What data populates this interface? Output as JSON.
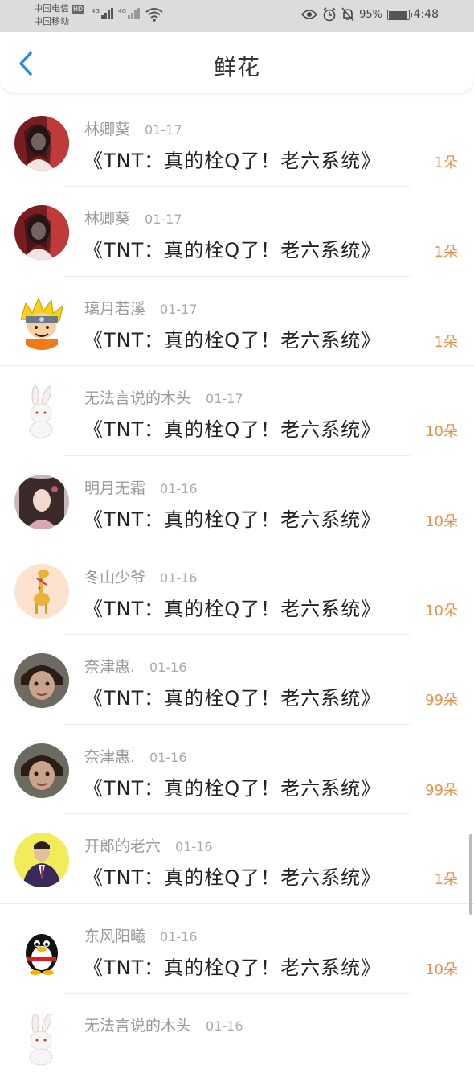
{
  "status_bar": {
    "carrier1": "中国电信",
    "hd": "HD",
    "carrier2": "中国移动",
    "network1": "4G",
    "network2": "4G",
    "battery_percent": "95%",
    "battery_level": 0.95,
    "time": "4:48"
  },
  "header": {
    "title": "鲜花"
  },
  "entries": [
    {
      "name": "林卿葵",
      "date": "01-17",
      "book": "《TNT：真的栓Q了！老六系统》",
      "count": "1朵",
      "avatar": "girl-red"
    },
    {
      "name": "林卿葵",
      "date": "01-17",
      "book": "《TNT：真的栓Q了！老六系统》",
      "count": "1朵",
      "avatar": "girl-red"
    },
    {
      "name": "璃月若溪",
      "date": "01-17",
      "book": "《TNT：真的栓Q了！老六系统》",
      "count": "1朵",
      "avatar": "naruto"
    },
    {
      "name": "无法言说的木头",
      "date": "01-17",
      "book": "《TNT：真的栓Q了！老六系统》",
      "count": "10朵",
      "avatar": "rabbit"
    },
    {
      "name": "明月无霜",
      "date": "01-16",
      "book": "《TNT：真的栓Q了！老六系统》",
      "count": "10朵",
      "avatar": "girl-ancient"
    },
    {
      "name": "冬山少爷",
      "date": "01-16",
      "book": "《TNT：真的栓Q了！老六系统》",
      "count": "10朵",
      "avatar": "giraffe"
    },
    {
      "name": "奈津惠.",
      "date": "01-16",
      "book": "《TNT：真的栓Q了！老六系统》",
      "count": "99朵",
      "avatar": "child"
    },
    {
      "name": "奈津惠.",
      "date": "01-16",
      "book": "《TNT：真的栓Q了！老六系统》",
      "count": "99朵",
      "avatar": "child"
    },
    {
      "name": "开郎的老六",
      "date": "01-16",
      "book": "《TNT：真的栓Q了！老六系统》",
      "count": "1朵",
      "avatar": "man-suit"
    },
    {
      "name": "东风阳曦",
      "date": "01-16",
      "book": "《TNT：真的栓Q了！老六系统》",
      "count": "10朵",
      "avatar": "qq-penguin"
    },
    {
      "name": "无法言说的木头",
      "date": "01-16",
      "book": "",
      "count": "",
      "avatar": "rabbit"
    }
  ],
  "colors": {
    "accent": "#2a8be0",
    "count": "#e8914a",
    "status_bg": "#dcdcdc"
  }
}
